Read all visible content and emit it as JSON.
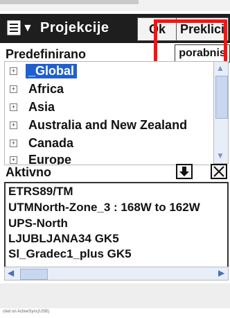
{
  "window": {
    "title": "Projekcije",
    "ok_label": "Ok",
    "cancel_label": "Preklici"
  },
  "predefined": {
    "label": "Predefinirano",
    "edit_label": "porabnis",
    "items": [
      {
        "label": "_Global",
        "selected": true
      },
      {
        "label": "Africa",
        "selected": false
      },
      {
        "label": "Asia",
        "selected": false
      },
      {
        "label": "Australia and New Zealand",
        "selected": false
      },
      {
        "label": "Canada",
        "selected": false
      },
      {
        "label": "Europe",
        "selected": false
      }
    ],
    "expander": "+"
  },
  "active": {
    "label": "Aktivno",
    "items": [
      "ETRS89/TM",
      "UTMNorth-Zone_3 : 168W to 162W",
      "UPS-North",
      "LJUBLJANA34 GK5",
      "Sl_Gradec1_plus GK5"
    ]
  },
  "footer": {
    "note": "cted on ActiveSync(USB)"
  },
  "colors": {
    "titlebar": "#1e1e1e",
    "selection": "#1f5fd0",
    "highlight_box": "#ff1010"
  }
}
